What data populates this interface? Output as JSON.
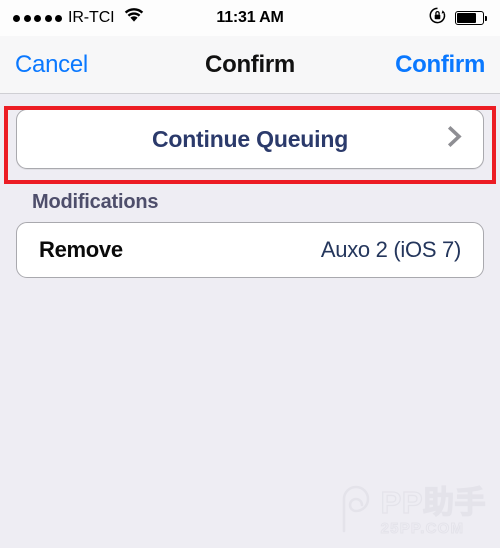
{
  "status_bar": {
    "signal_dots": 5,
    "carrier": "IR-TCI",
    "wifi_icon": "wifi-icon",
    "time": "11:31 AM",
    "rotation_lock_icon": "rotation-lock-icon",
    "battery_icon": "battery-icon",
    "battery_level_percent": 78
  },
  "nav_bar": {
    "cancel_label": "Cancel",
    "title": "Confirm",
    "confirm_label": "Confirm",
    "tint_color": "#0a78ff"
  },
  "main": {
    "continue_button": {
      "label": "Continue Queuing",
      "chevron_icon": "chevron-right-icon",
      "text_color": "#2b3a6b"
    },
    "modifications": {
      "header": "Modifications",
      "rows": [
        {
          "action": "Remove",
          "package": "Auxo 2 (iOS 7)"
        }
      ]
    }
  },
  "annotation": {
    "highlight_color": "#ec1c24",
    "target": "continue-queuing-button"
  },
  "watermark": {
    "logo_icon": "pp-logo-icon",
    "main_text": "PP助手",
    "sub_text": "25PP.COM"
  }
}
